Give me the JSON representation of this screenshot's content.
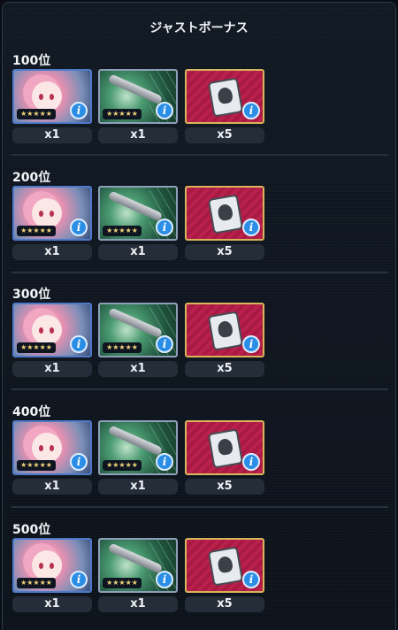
{
  "title": "ジャストボーナス",
  "tiers": [
    {
      "rank": "100位",
      "rewards": [
        {
          "name": "character-card",
          "quantity": "x1",
          "stars": "★★★★★"
        },
        {
          "name": "missile-equipment",
          "quantity": "x1",
          "stars": "★★★★★"
        },
        {
          "name": "ticket-item",
          "quantity": "x5"
        }
      ]
    },
    {
      "rank": "200位",
      "rewards": [
        {
          "name": "character-card",
          "quantity": "x1",
          "stars": "★★★★★"
        },
        {
          "name": "missile-equipment",
          "quantity": "x1",
          "stars": "★★★★★"
        },
        {
          "name": "ticket-item",
          "quantity": "x5"
        }
      ]
    },
    {
      "rank": "300位",
      "rewards": [
        {
          "name": "character-card",
          "quantity": "x1",
          "stars": "★★★★★"
        },
        {
          "name": "missile-equipment",
          "quantity": "x1",
          "stars": "★★★★★"
        },
        {
          "name": "ticket-item",
          "quantity": "x5"
        }
      ]
    },
    {
      "rank": "400位",
      "rewards": [
        {
          "name": "character-card",
          "quantity": "x1",
          "stars": "★★★★★"
        },
        {
          "name": "missile-equipment",
          "quantity": "x1",
          "stars": "★★★★★"
        },
        {
          "name": "ticket-item",
          "quantity": "x5"
        }
      ]
    },
    {
      "rank": "500位",
      "rewards": [
        {
          "name": "character-card",
          "quantity": "x1",
          "stars": "★★★★★"
        },
        {
          "name": "missile-equipment",
          "quantity": "x1",
          "stars": "★★★★★"
        },
        {
          "name": "ticket-item",
          "quantity": "x5"
        }
      ]
    }
  ],
  "colors": {
    "panel_bg": "#111820",
    "info_badge": "#2b8ee6",
    "character_frame": "#4f79c9",
    "ticket_frame": "#d8b45a"
  },
  "icons": {
    "info": "info-icon"
  },
  "info_glyph": "i"
}
